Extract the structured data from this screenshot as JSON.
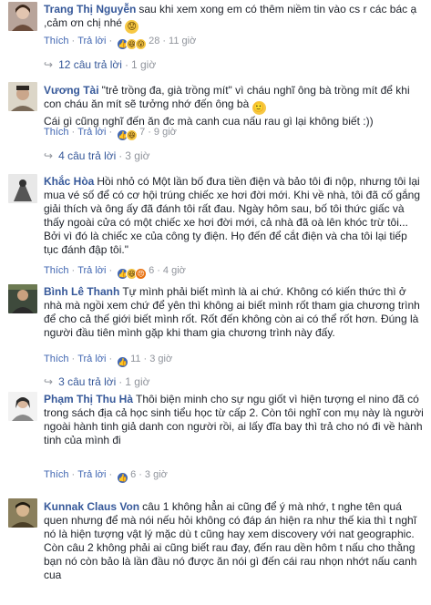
{
  "comments": [
    {
      "name": "Trang Thị Nguyễn",
      "text": "sau khi xem xong em có thêm niềm tin vào cs r các bác ạ ,cảm ơn chị nhé",
      "emoji": "😟",
      "like_label": "Thích",
      "reply_label": "Trả lời",
      "reaction_count": "28",
      "time": "11 giờ",
      "replies_label": "12 câu trả lời",
      "replies_time": "1 giờ"
    },
    {
      "name": "Vương Tài",
      "text": "\"trẻ trồng đa, già trồng mít\" vì cháu nghĩ ông bà trồng mít để khi con cháu ăn mít sẽ tưởng nhớ đến ông bà",
      "emoji": "🙂",
      "text2": "Cái gì cũng nghĩ đến ăn đc mà canh cua nấu rau gì lại không biết :))",
      "like_label": "Thích",
      "reply_label": "Trả lời",
      "reaction_count": "7",
      "time": "9 giờ",
      "replies_label": "4 câu trả lời",
      "replies_time": "3 giờ"
    },
    {
      "name": "Khắc Hòa",
      "text": "Hồi nhỏ có Một lần bố đưa tiền điện và bảo tôi đi nộp, nhưng tôi lại mua vé số để có cơ hội trúng chiếc xe hơi đời mới. Khi về nhà, tôi đã cố gắng giải thích và ông ấy đã đánh tôi rất đau. Ngày hôm sau, bố tôi thức giấc và thấy ngoài cửa có một chiếc xe hơi đời mới, cả nhà đã oà lên khóc trừ tôi... Bởi vì đó là chiếc xe của công ty điện. Họ đến để cắt điện và cha tôi lại tiếp tục đánh đập tôi.\"",
      "like_label": "Thích",
      "reply_label": "Trả lời",
      "reaction_count": "6",
      "time": "4 giờ"
    },
    {
      "name": "Bình Lê Thanh",
      "text": "Tự mình phải biết mình là ai chứ. Không có kiến thức thì ở nhà mà ngồi xem chứ để yên thì không ai biết mình rốt tham gia chương trình để cho cả thế giới biết mình rốt. Rốt đến không còn ai có thể rốt hơn. Đúng là người đầu tiên mình gặp khi tham gia chương trình này đấy.",
      "like_label": "Thích",
      "reply_label": "Trả lời",
      "reaction_count": "11",
      "time": "3 giờ",
      "replies_label": "3 câu trả lời",
      "replies_time": "1 giờ"
    },
    {
      "name": "Phạm Thị Thu Hà",
      "text": "Thôi biện minh cho sự ngu giốt vì hiện tượng el nino đã có trong sách địa cả học sinh tiểu học từ cấp 2. Còn tôi nghĩ con mụ này là người ngoài hành tinh giả danh con người rồi, ai lấy đĩa bay thì trả cho nó đi về hành tinh của mình đi",
      "like_label": "Thích",
      "reply_label": "Trả lời",
      "reaction_count": "6",
      "time": "3 giờ"
    },
    {
      "name": "Kunnak Claus Von",
      "text": "câu 1 không hẳn ai cũng để ý mà nhớ, t nghe tên quá quen nhưng để mà nói nếu hỏi không có đáp án hiện ra như thế kia thì t nghĩ nó là hiện tượng vật lý mặc dù t cũng hay xem discovery với nat geographic. Còn câu 2 không phải ai cũng biết rau đay, đến rau dền hôm t nấu cho thằng bạn nó còn bảo là lần đầu nó được ăn nói gì đến cái rau nhọn nhớt nấu canh cua"
    }
  ],
  "reaction_icons": [
    "like",
    "haha",
    "wow",
    "angry"
  ]
}
